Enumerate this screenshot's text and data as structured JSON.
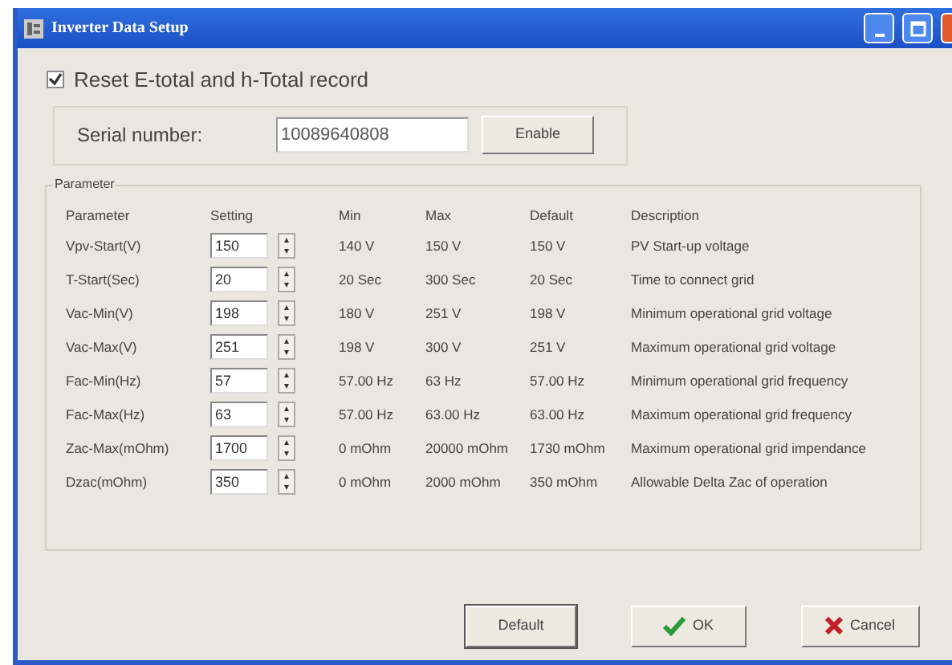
{
  "window": {
    "title": "Inverter Data Setup"
  },
  "reset_checkbox": {
    "label": "Reset E-total and h-Total record",
    "checked": true
  },
  "serial": {
    "label": "Serial number:",
    "value": "10089640808",
    "button": "Enable"
  },
  "parameter_group": {
    "title": "Parameter",
    "columns": [
      "Parameter",
      "Setting",
      "Min",
      "Max",
      "Default",
      "Description"
    ],
    "rows": [
      {
        "name": "Vpv-Start(V)",
        "setting": "150",
        "min": "140 V",
        "max": "150 V",
        "default": "150 V",
        "description": "PV Start-up voltage"
      },
      {
        "name": "T-Start(Sec)",
        "setting": "20",
        "min": "20 Sec",
        "max": "300 Sec",
        "default": "20 Sec",
        "description": "Time to connect grid"
      },
      {
        "name": "Vac-Min(V)",
        "setting": "198",
        "min": "180 V",
        "max": "251 V",
        "default": "198 V",
        "description": "Minimum operational grid voltage"
      },
      {
        "name": "Vac-Max(V)",
        "setting": "251",
        "min": "198 V",
        "max": "300 V",
        "default": "251 V",
        "description": "Maximum operational grid voltage"
      },
      {
        "name": "Fac-Min(Hz)",
        "setting": "57",
        "min": "57.00 Hz",
        "max": "63 Hz",
        "default": "57.00 Hz",
        "description": "Minimum operational grid frequency"
      },
      {
        "name": "Fac-Max(Hz)",
        "setting": "63",
        "min": "57.00 Hz",
        "max": "63.00 Hz",
        "default": "63.00 Hz",
        "description": "Maximum operational grid frequency"
      },
      {
        "name": "Zac-Max(mOhm)",
        "setting": "1700",
        "min": "0 mOhm",
        "max": "20000 mOhm",
        "default": "1730 mOhm",
        "description": "Maximum operational grid impendance"
      },
      {
        "name": "Dzac(mOhm)",
        "setting": "350",
        "min": "0 mOhm",
        "max": "2000 mOhm",
        "default": "350 mOhm",
        "description": "Allowable Delta Zac of operation"
      }
    ]
  },
  "buttons": [
    {
      "kind": "default",
      "label": "Default"
    },
    {
      "kind": "ok",
      "label": "OK"
    },
    {
      "kind": "cancel",
      "label": "Cancel"
    }
  ]
}
